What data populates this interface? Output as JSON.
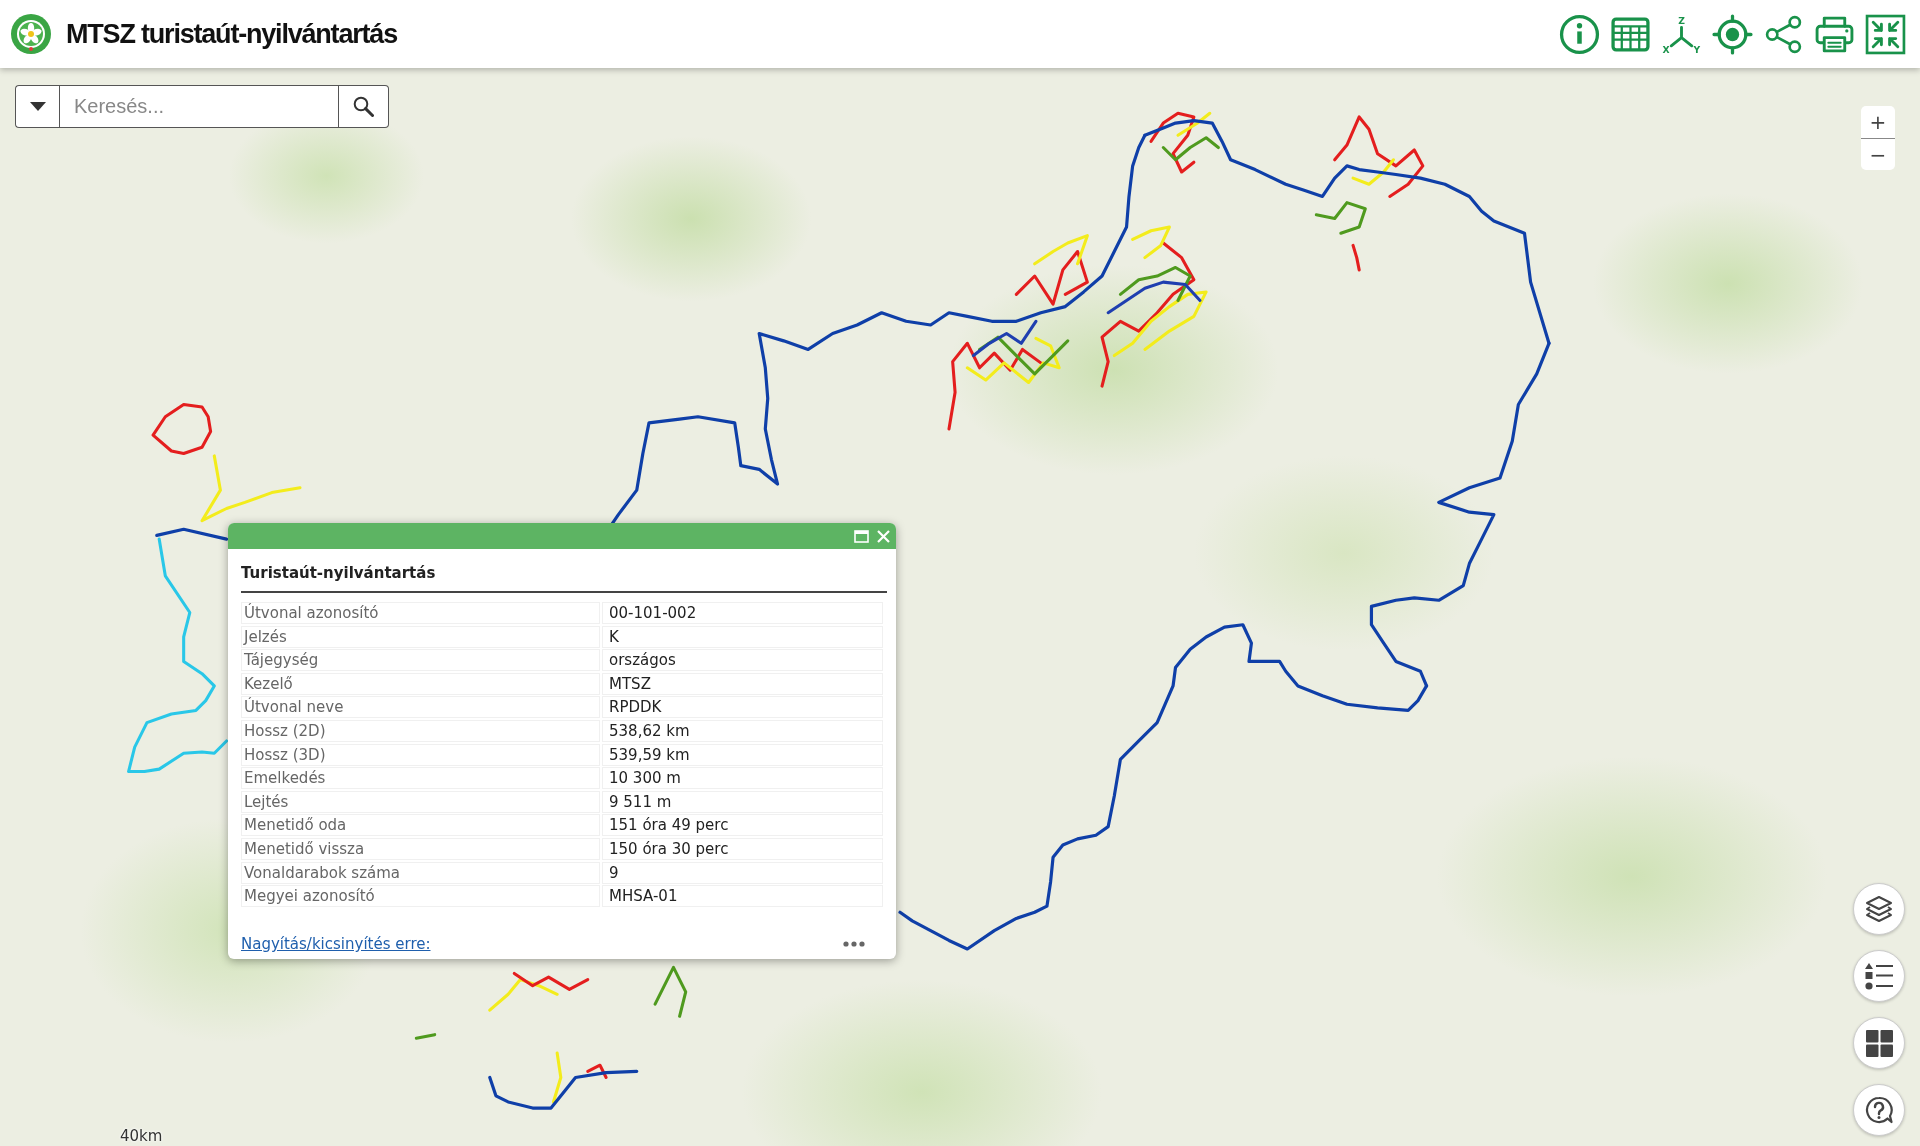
{
  "header": {
    "title": "MTSZ turistaút-nyilvántartás",
    "coordinates_tool": {
      "axis_letters": [
        "Z",
        "X",
        "Y"
      ]
    }
  },
  "search": {
    "placeholder": "Keresés..."
  },
  "zoom_control": {
    "zoom_in": "+",
    "zoom_out": "−"
  },
  "popup": {
    "title": "Turistaút-nyilvántartás",
    "rows": [
      {
        "label": "Útvonal azonosító",
        "value": "00-101-002"
      },
      {
        "label": "Jelzés",
        "value": "K"
      },
      {
        "label": "Tájegység",
        "value": "országos"
      },
      {
        "label": "Kezelő",
        "value": "MTSZ"
      },
      {
        "label": "Útvonal neve",
        "value": "RPDDK"
      },
      {
        "label": "Hossz (2D)",
        "value": "538,62 km"
      },
      {
        "label": "Hossz (3D)",
        "value": "539,59 km"
      },
      {
        "label": "Emelkedés",
        "value": "10 300 m"
      },
      {
        "label": "Lejtés",
        "value": "9 511 m"
      },
      {
        "label": "Menetidő oda",
        "value": "151 óra 49 perc"
      },
      {
        "label": "Menetidő vissza",
        "value": "150 óra 30 perc"
      },
      {
        "label": "Vonaldarabok száma",
        "value": "9"
      },
      {
        "label": "Megyei azonosító",
        "value": "MHSA-01"
      }
    ],
    "zoom_link": "Nagyítás/kicsinyítés erre:"
  },
  "scale_bar": {
    "label": "40km"
  }
}
